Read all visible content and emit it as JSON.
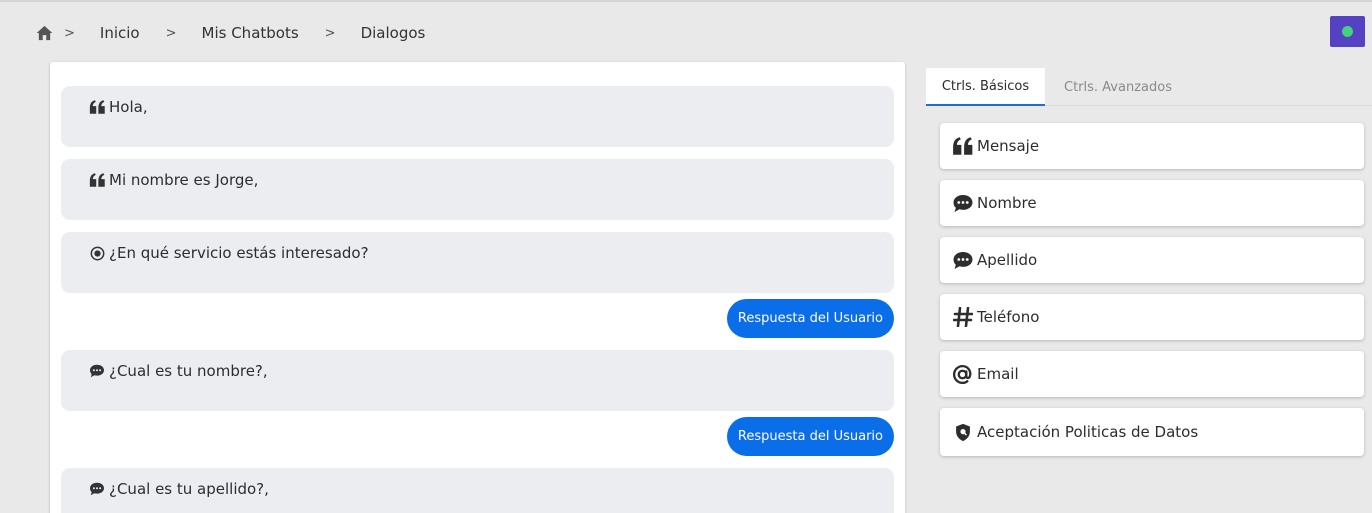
{
  "breadcrumb": {
    "items": [
      "Inicio",
      "Mis Chatbots",
      "Dialogos"
    ],
    "separator": ">"
  },
  "colors": {
    "accent": "#0a6ee8",
    "status_button": "#5442c2",
    "status_online": "#44d27a"
  },
  "dialog": {
    "messages": [
      {
        "icon": "quote-icon",
        "text": "Hola,"
      },
      {
        "icon": "quote-icon",
        "text": "Mi nombre es Jorge,"
      },
      {
        "icon": "radio-icon",
        "text": "¿En qué servicio estás interesado?"
      },
      {
        "icon": "chat-icon",
        "text": "¿Cual es tu nombre?,"
      },
      {
        "icon": "chat-icon",
        "text": "¿Cual es tu apellido?,"
      }
    ],
    "reply_label": "Respuesta del Usuario"
  },
  "tabs": {
    "basic": "Ctrls. Básicos",
    "advanced": "Ctrls. Avanzados"
  },
  "controls": [
    {
      "icon": "quote-icon",
      "label": "Mensaje"
    },
    {
      "icon": "chat-icon",
      "label": "Nombre"
    },
    {
      "icon": "chat-icon",
      "label": "Apellido"
    },
    {
      "icon": "hash-icon",
      "label": "Teléfono"
    },
    {
      "icon": "at-icon",
      "label": "Email"
    },
    {
      "icon": "shield-icon",
      "label": "Aceptación Politicas de Datos"
    }
  ]
}
